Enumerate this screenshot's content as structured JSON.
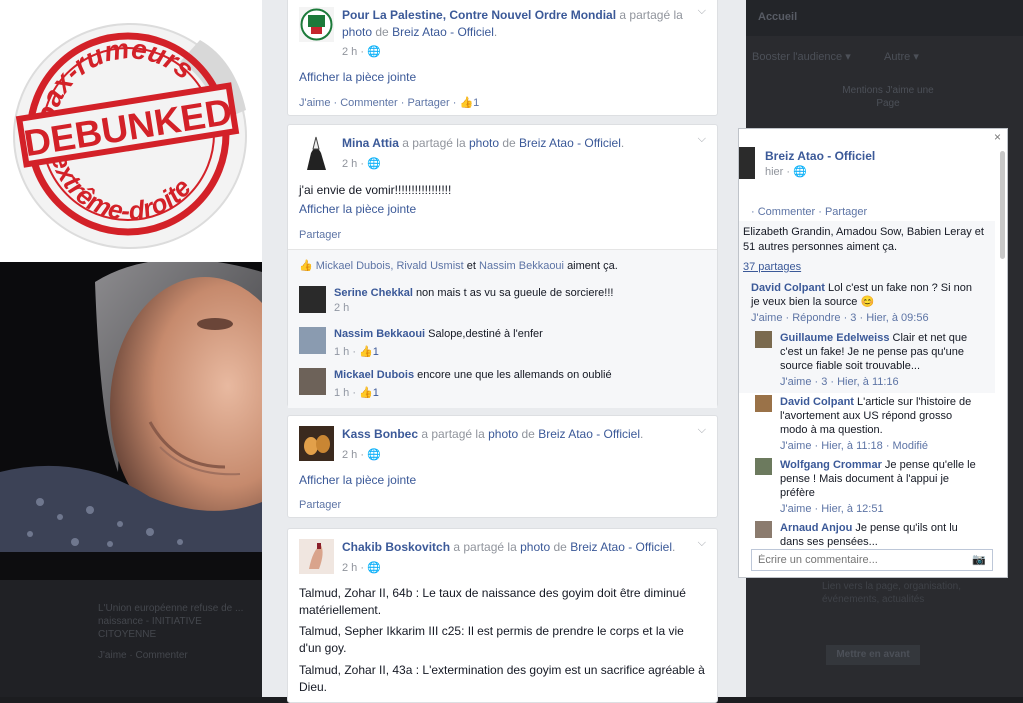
{
  "bg": {
    "topbar": "Accueil",
    "menu1": "Booster l'audience ▾",
    "menu2": "Autre ▾",
    "menu3": "Mentions J'aime une Page",
    "bottom": "Lien vers la page, organisation, événements, actualités",
    "btn": "Mettre en avant",
    "left_text": "L'Union européenne refuse de ... naissance - INITIATIVE CITOYENNE",
    "left_text2": "J'aime · Commenter"
  },
  "stamp": {
    "top": "Hoax-rumeurs",
    "center": "DEBUNKED",
    "bottom": "d'extrême-droite"
  },
  "posts": [
    {
      "author": "Pour La Palestine, Contre Nouvel Ordre Mondial",
      "shared": "a partagé la",
      "photo": "photo",
      "de": "de",
      "page": "Breiz Atao - Officiel",
      "time": "2 h",
      "attach": "Afficher la pièce jointe",
      "actions": "J'aime · Commenter · Partager ·",
      "likes": "1"
    },
    {
      "author": "Mina Attia",
      "shared": "a partagé la",
      "photo": "photo",
      "de": "de",
      "page": "Breiz Atao - Officiel",
      "time": "2 h",
      "text": "j'ai envie de vomir!!!!!!!!!!!!!!!!!",
      "attach": "Afficher la pièce jointe",
      "actions": "Partager",
      "like_bar": {
        "names": "Mickael Dubois, Rivald Usmist",
        "and": "et",
        "last": "Nassim Bekkaoui",
        "suffix": "aiment ça."
      },
      "comments": [
        {
          "name": "Serine Chekkal",
          "text": "non mais t as vu sa gueule de sorciere!!!",
          "meta": "2 h",
          "likes": ""
        },
        {
          "name": "Nassim Bekkaoui",
          "text": "Salope,destiné à l'enfer",
          "meta": "1 h ·",
          "likes": "1"
        },
        {
          "name": "Mickael Dubois",
          "text": "encore une que les allemands on oublié",
          "meta": "1 h ·",
          "likes": "1"
        }
      ]
    },
    {
      "author": "Kass Bonbec",
      "shared": "a partagé la",
      "photo": "photo",
      "de": "de",
      "page": "Breiz Atao - Officiel",
      "time": "2 h",
      "attach": "Afficher la pièce jointe",
      "actions": "Partager"
    },
    {
      "author": "Chakib Boskovitch",
      "shared": "a partagé la",
      "photo": "photo",
      "de": "de",
      "page": "Breiz Atao - Officiel",
      "time": "2 h",
      "lines": [
        "Talmud, Zohar II, 64b : Le taux de naissance des goyim doit être diminué matériellement.",
        "Talmud, Sepher Ikkarim III c25: Il est permis de prendre le corps et la vie d'un goy.",
        "Talmud, Zohar II, 43a : L'extermination des goyim est un sacrifice agréable à Dieu."
      ]
    }
  ],
  "popup": {
    "close": "×",
    "title": "Breiz Atao - Officiel",
    "time": "hier ·",
    "actions": "· Commenter · Partager",
    "likes_text": "Elizabeth Grandin, Amadou Sow, Babien Leray et 51 autres personnes aiment ça.",
    "shares": "37 partages",
    "comments": [
      {
        "name": "David Colpant",
        "text": "Lol c'est un fake non ? Si non je veux bien la source 😊",
        "meta": "J'aime · Répondre · 3 · Hier, à 09:56"
      },
      {
        "name": "Guillaume Edelweiss",
        "text": "Clair et net que c'est un fake! Je ne pense pas qu'une source fiable soit trouvable...",
        "meta": "J'aime · 3 · Hier, à 11:16"
      },
      {
        "name": "David Colpant",
        "text": "L'article sur l'histoire de l'avortement aux US répond grosso modo à ma question.",
        "meta": "J'aime · Hier, à 11:18 · Modifié"
      },
      {
        "name": "Wolfgang Crommar",
        "text": "Je pense qu'elle le pense ! Mais document à l'appui je préfère",
        "meta": "J'aime · Hier, à 12:51"
      },
      {
        "name": "Arnaud Anjou",
        "text": "Je pense qu'ils ont lu dans ses pensées...",
        "meta": ""
      }
    ],
    "composer_placeholder": "Écrire un commentaire..."
  }
}
